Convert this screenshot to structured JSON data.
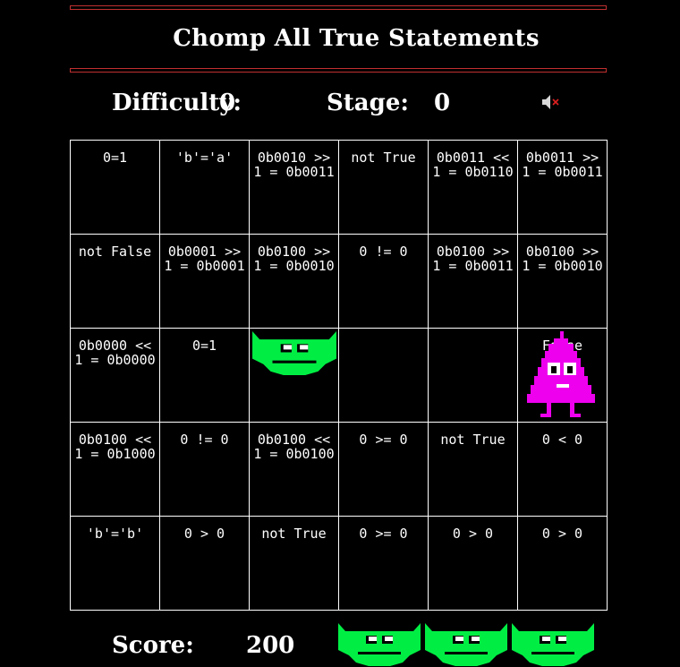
{
  "title": "Chomp All True Statements",
  "status": {
    "difficulty_label": "Difficulty:",
    "difficulty_value": "0",
    "stage_label": "Stage:",
    "stage_value": "0",
    "sound_icon": "speaker-muted-icon"
  },
  "score": {
    "label": "Score:",
    "value": "200"
  },
  "lives_remaining": 3,
  "colors": {
    "background": "#000000",
    "rule": "#c03030",
    "player": "#00ee44",
    "enemy": "#ee00ee",
    "grid_line": "#ffffff",
    "mute_x": "#e02020"
  },
  "grid": {
    "rows": 5,
    "cols": 6,
    "cells": [
      [
        "0=1",
        "'b'='a'",
        "0b0010 >>\n1 = 0b0011",
        "not True",
        "0b0011 <<\n1 = 0b0110",
        "0b0011 >>\n1 = 0b0011"
      ],
      [
        "not False",
        "0b0001 >>\n1 = 0b0001",
        "0b0100 >>\n1 = 0b0010",
        "0 != 0",
        "0b0100 >>\n1 = 0b0011",
        "0b0100 >>\n1 = 0b0010"
      ],
      [
        "0b0000 <<\n1 = 0b0000",
        "0=1",
        "",
        "",
        "",
        "False"
      ],
      [
        "0b0100 <<\n1 = 0b1000",
        "0 != 0",
        "0b0100 <<\n1 = 0b0100",
        "0 >= 0",
        "not True",
        "0 < 0"
      ],
      [
        "'b'='b'",
        "0 > 0",
        "not True",
        "0 >= 0",
        "0 > 0",
        "0 > 0"
      ]
    ],
    "player_cell": [
      2,
      2
    ],
    "enemy_cell": [
      2,
      5
    ]
  }
}
